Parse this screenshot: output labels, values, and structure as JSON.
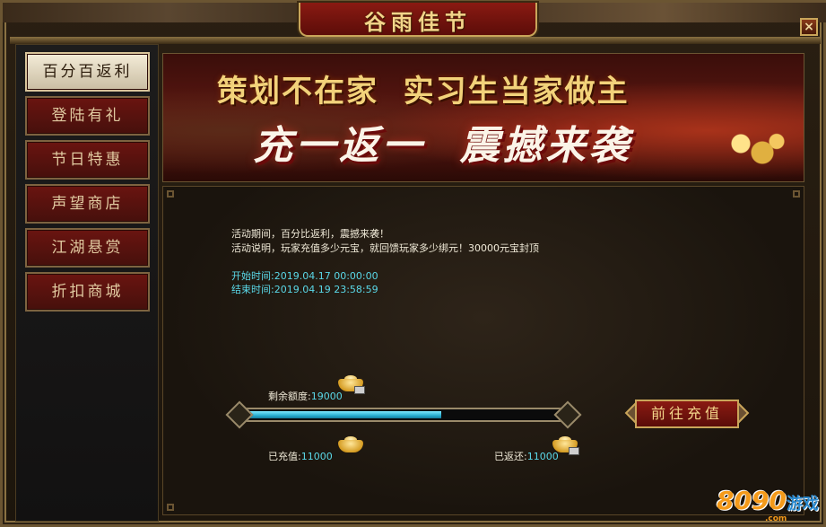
{
  "window": {
    "title": "谷雨佳节",
    "close_glyph": "×"
  },
  "sidebar": {
    "items": [
      {
        "label": "百分百返利",
        "active": true
      },
      {
        "label": "登陆有礼",
        "active": false
      },
      {
        "label": "节日特惠",
        "active": false
      },
      {
        "label": "声望商店",
        "active": false
      },
      {
        "label": "江湖悬赏",
        "active": false
      },
      {
        "label": "折扣商城",
        "active": false
      }
    ]
  },
  "banner": {
    "line1": "策划不在家  实习生当家做主",
    "line2": "充一返一  震撼来袭"
  },
  "activity": {
    "period": "活动期间，百分比返利，震撼来袭！",
    "description": "活动说明，玩家充值多少元宝，就回馈玩家多少绑元！30000元宝封顶",
    "start_label": "开始时间:",
    "start_time": "2019.04.17 00:00:00",
    "end_label": "结束时间:",
    "end_time": "2019.04.19 23:58:59"
  },
  "quota": {
    "remaining_label": "剩余额度:",
    "remaining_value": "19000",
    "charged_label": "已充值:",
    "charged_value": "11000",
    "returned_label": "已返还:",
    "returned_value": "11000",
    "progress_fraction": 0.62
  },
  "charge_button": {
    "label": "前往充值"
  },
  "logo": {
    "digits": "8090",
    "cn": "游戏",
    "com": ".com"
  },
  "colors": {
    "accent_gold": "#c9a55a",
    "title_red": "#8a1a12",
    "value_cyan": "#5ad8e8",
    "progress_blue": "#2aaed0"
  },
  "icons": [
    "close-icon",
    "gold-ingot-icon",
    "progress-diamond-icon"
  ]
}
